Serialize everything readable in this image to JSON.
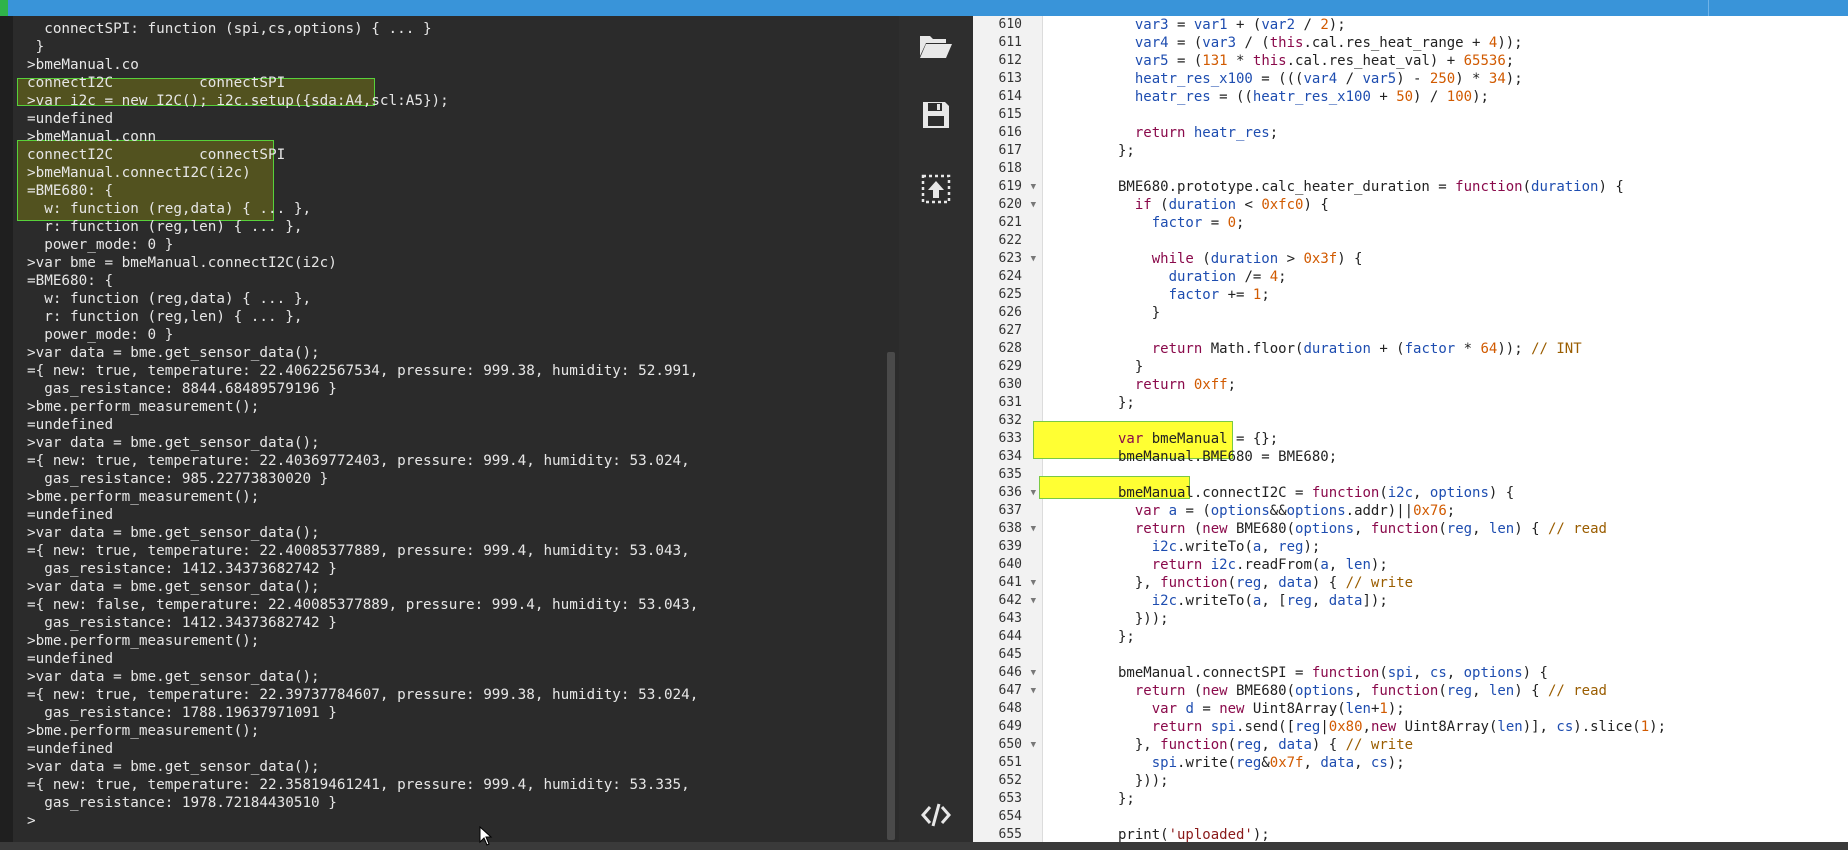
{
  "terminal": {
    "lines": [
      "  connectSPI: function (spi,cs,options) { ... }",
      " }",
      ">bmeManual.co",
      "connectI2C          connectSPI",
      ">var i2c = new I2C(); i2c.setup({sda:A4,scl:A5});",
      "=undefined",
      ">bmeManual.conn",
      "connectI2C          connectSPI",
      ">bmeManual.connectI2C(i2c)",
      "=BME680: {",
      "  w: function (reg,data) { ... },",
      "  r: function (reg,len) { ... },",
      "  power_mode: 0 }",
      ">var bme = bmeManual.connectI2C(i2c)",
      "=BME680: {",
      "  w: function (reg,data) { ... },",
      "  r: function (reg,len) { ... },",
      "  power_mode: 0 }",
      ">var data = bme.get_sensor_data();",
      "={ new: true, temperature: 22.40622567534, pressure: 999.38, humidity: 52.991,",
      "  gas_resistance: 8844.68489579196 }",
      ">bme.perform_measurement();",
      "=undefined",
      ">var data = bme.get_sensor_data();",
      "={ new: true, temperature: 22.40369772403, pressure: 999.4, humidity: 53.024,",
      "  gas_resistance: 985.22773830020 }",
      ">bme.perform_measurement();",
      "=undefined",
      ">var data = bme.get_sensor_data();",
      "={ new: true, temperature: 22.40085377889, pressure: 999.4, humidity: 53.043,",
      "  gas_resistance: 1412.34373682742 }",
      ">var data = bme.get_sensor_data();",
      "={ new: false, temperature: 22.40085377889, pressure: 999.4, humidity: 53.043,",
      "  gas_resistance: 1412.34373682742 }",
      ">bme.perform_measurement();",
      "=undefined",
      ">var data = bme.get_sensor_data();",
      "={ new: true, temperature: 22.39737784607, pressure: 999.38, humidity: 53.024,",
      "  gas_resistance: 1788.19637971091 }",
      ">bme.perform_measurement();",
      "=undefined",
      ">var data = bme.get_sensor_data();",
      "={ new: true, temperature: 22.35819461241, pressure: 999.4, humidity: 53.335,",
      "  gas_resistance: 1978.72184430510 }",
      ">"
    ]
  },
  "toolbar": {
    "open_icon": "folder-open-icon",
    "save_icon": "save-icon",
    "upload_icon": "upload-to-device-icon",
    "code_icon": "code-icon"
  },
  "editor": {
    "line_numbers": [
      "610",
      "611",
      "612",
      "613",
      "614",
      "615",
      "616",
      "617",
      "618",
      "619",
      "620",
      "621",
      "622",
      "623",
      "624",
      "625",
      "626",
      "627",
      "628",
      "629",
      "630",
      "631",
      "632",
      "633",
      "634",
      "635",
      "636",
      "637",
      "638",
      "639",
      "640",
      "641",
      "642",
      "643",
      "644",
      "645",
      "646",
      "647",
      "648",
      "649",
      "650",
      "651",
      "652",
      "653",
      "654",
      "655"
    ],
    "folded_lines": [
      "619",
      "620",
      "623",
      "636",
      "638",
      "641",
      "642",
      "646",
      "647",
      "650"
    ],
    "code_lines": [
      "  var3 = var1 + (var2 / 2);",
      "  var4 = (var3 / (this.cal.res_heat_range + 4));",
      "  var5 = (131 * this.cal.res_heat_val) + 65536;",
      "  heatr_res_x100 = (((var4 / var5) - 250) * 34);",
      "  heatr_res = ((heatr_res_x100 + 50) / 100);",
      "",
      "  return heatr_res;",
      "};",
      "",
      "BME680.prototype.calc_heater_duration = function(duration) {",
      "  if (duration < 0xfc0) {",
      "    factor = 0;",
      "",
      "    while (duration > 0x3f) {",
      "      duration /= 4;",
      "      factor += 1;",
      "    }",
      "",
      "    return Math.floor(duration + (factor * 64)); // INT",
      "  }",
      "  return 0xff;",
      "};",
      "",
      "var bmeManual = {};",
      "bmeManual.BME680 = BME680;",
      "",
      "bmeManual.connectI2C = function(i2c, options) {",
      "  var a = (options&&options.addr)||0x76;",
      "  return (new BME680(options, function(reg, len) { // read",
      "    i2c.writeTo(a, reg);",
      "    return i2c.readFrom(a, len);",
      "  }, function(reg, data) { // write",
      "    i2c.writeTo(a, [reg, data]);",
      "  }));",
      "};",
      "",
      "bmeManual.connectSPI = function(spi, cs, options) {",
      "  return (new BME680(options, function(reg, len) { // read",
      "    var d = new Uint8Array(len+1);",
      "    return spi.send([reg|0x80,new Uint8Array(len)], cs).slice(1);",
      "  }, function(reg, data) { // write",
      "    spi.write(reg&0x7f, data, cs);",
      "  }));",
      "};",
      "",
      "print('uploaded');"
    ]
  },
  "colors": {
    "title_bar": "#3994d9",
    "terminal_bg": "#2b2b2b",
    "highlight_yellow": "#ffff33",
    "highlight_border": "#58d13a"
  }
}
